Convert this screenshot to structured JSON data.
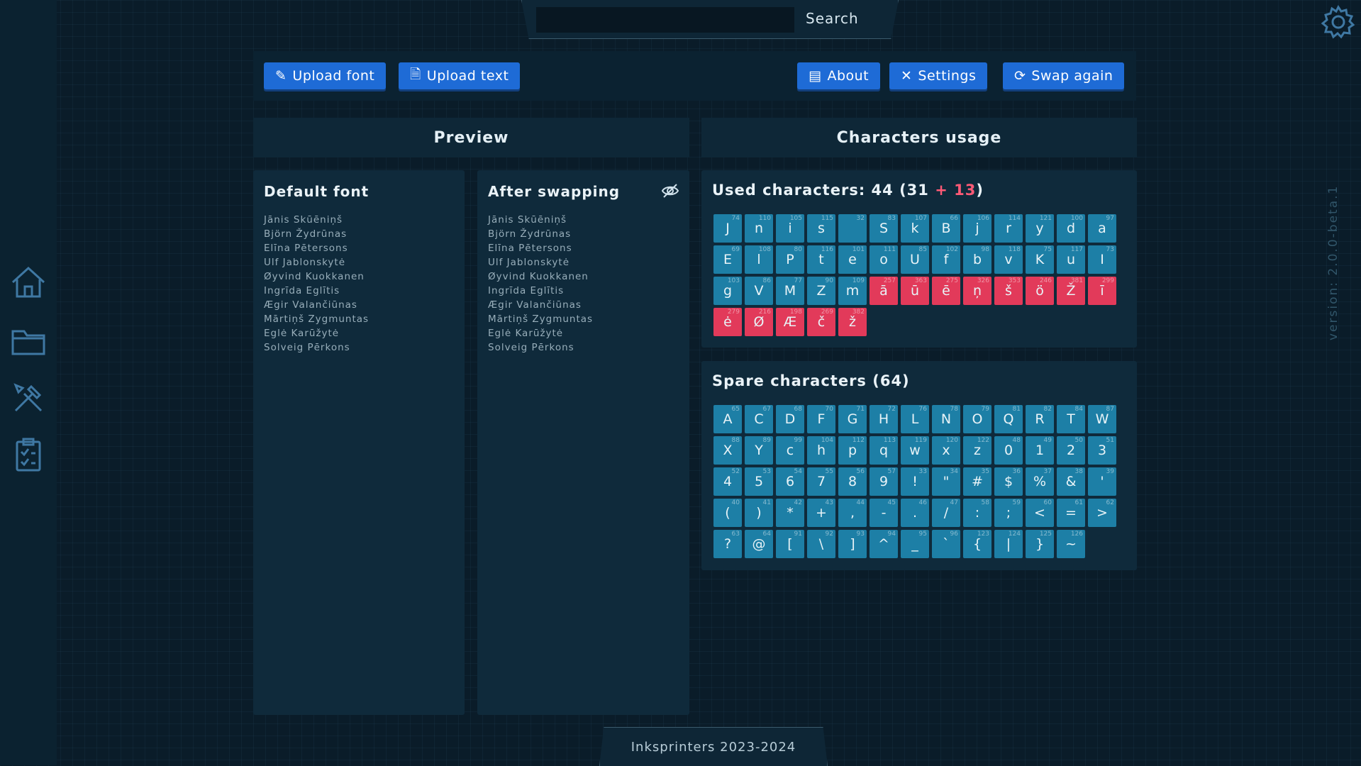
{
  "search": {
    "label": "Search",
    "placeholder": ""
  },
  "toolbar": {
    "upload_font": "Upload font",
    "upload_text": "Upload text",
    "about": "About",
    "settings": "Settings",
    "swap_again": "Swap again"
  },
  "panels": {
    "preview": "Preview",
    "characters_usage": "Characters usage"
  },
  "preview": {
    "default_font_title": "Default font",
    "after_swapping_title": "After swapping",
    "names": [
      "Jānis Skūēniņš",
      "Björn Žydrūnas",
      "Elīna Pētersons",
      "Ulf Jablonskytė",
      "Øyvind Kuokkanen",
      "Ingrīda Eglītis",
      "Ægir Valančiūnas",
      "Mārtiņš Zygmuntas",
      "Eglė Karūžytė",
      "Solveig Pērkons"
    ],
    "names_text": "Jānis Skūēniņš\nBjörn Žydrūnas\nElīna Pētersons\nUlf Jablonskytė\nØyvind Kuokkanen\nIngrīda Eglītis\nÆgir Valančiūnas\nMārtiņš Zygmuntas\nEglė Karūžytė\nSolveig Pērkons"
  },
  "used": {
    "title_prefix": "Used characters: 44 (31",
    "plus": " + 13",
    "suffix": ")",
    "chars": [
      {
        "c": "J",
        "n": "74",
        "s": false
      },
      {
        "c": "n",
        "n": "110",
        "s": false
      },
      {
        "c": "i",
        "n": "105",
        "s": false
      },
      {
        "c": "s",
        "n": "115",
        "s": false
      },
      {
        "c": "",
        "n": "32",
        "s": false
      },
      {
        "c": "S",
        "n": "83",
        "s": false
      },
      {
        "c": "k",
        "n": "107",
        "s": false
      },
      {
        "c": "B",
        "n": "66",
        "s": false
      },
      {
        "c": "j",
        "n": "106",
        "s": false
      },
      {
        "c": "r",
        "n": "114",
        "s": false
      },
      {
        "c": "y",
        "n": "121",
        "s": false
      },
      {
        "c": "d",
        "n": "100",
        "s": false
      },
      {
        "c": "a",
        "n": "97",
        "s": false
      },
      {
        "c": "E",
        "n": "69",
        "s": false
      },
      {
        "c": "l",
        "n": "108",
        "s": false
      },
      {
        "c": "P",
        "n": "80",
        "s": false
      },
      {
        "c": "t",
        "n": "116",
        "s": false
      },
      {
        "c": "e",
        "n": "101",
        "s": false
      },
      {
        "c": "o",
        "n": "111",
        "s": false
      },
      {
        "c": "U",
        "n": "85",
        "s": false
      },
      {
        "c": "f",
        "n": "102",
        "s": false
      },
      {
        "c": "b",
        "n": "98",
        "s": false
      },
      {
        "c": "v",
        "n": "118",
        "s": false
      },
      {
        "c": "K",
        "n": "75",
        "s": false
      },
      {
        "c": "u",
        "n": "117",
        "s": false
      },
      {
        "c": "I",
        "n": "73",
        "s": false
      },
      {
        "c": "g",
        "n": "103",
        "s": false
      },
      {
        "c": "V",
        "n": "86",
        "s": false
      },
      {
        "c": "M",
        "n": "77",
        "s": false
      },
      {
        "c": "Z",
        "n": "90",
        "s": false
      },
      {
        "c": "m",
        "n": "109",
        "s": false
      },
      {
        "c": "ā",
        "n": "257",
        "s": true
      },
      {
        "c": "ū",
        "n": "363",
        "s": true
      },
      {
        "c": "ē",
        "n": "275",
        "s": true
      },
      {
        "c": "ņ",
        "n": "326",
        "s": true
      },
      {
        "c": "š",
        "n": "353",
        "s": true
      },
      {
        "c": "ö",
        "n": "246",
        "s": true
      },
      {
        "c": "Ž",
        "n": "381",
        "s": true
      },
      {
        "c": "ī",
        "n": "299",
        "s": true
      },
      {
        "c": "ė",
        "n": "279",
        "s": true
      },
      {
        "c": "Ø",
        "n": "216",
        "s": true
      },
      {
        "c": "Æ",
        "n": "198",
        "s": true
      },
      {
        "c": "č",
        "n": "269",
        "s": true
      },
      {
        "c": "ž",
        "n": "382",
        "s": true
      }
    ]
  },
  "spare": {
    "title": "Spare characters (64)",
    "chars": [
      {
        "c": "A",
        "n": "65"
      },
      {
        "c": "C",
        "n": "67"
      },
      {
        "c": "D",
        "n": "68"
      },
      {
        "c": "F",
        "n": "70"
      },
      {
        "c": "G",
        "n": "71"
      },
      {
        "c": "H",
        "n": "72"
      },
      {
        "c": "L",
        "n": "76"
      },
      {
        "c": "N",
        "n": "78"
      },
      {
        "c": "O",
        "n": "79"
      },
      {
        "c": "Q",
        "n": "81"
      },
      {
        "c": "R",
        "n": "82"
      },
      {
        "c": "T",
        "n": "84"
      },
      {
        "c": "W",
        "n": "87"
      },
      {
        "c": "X",
        "n": "88"
      },
      {
        "c": "Y",
        "n": "89"
      },
      {
        "c": "c",
        "n": "99"
      },
      {
        "c": "h",
        "n": "104"
      },
      {
        "c": "p",
        "n": "112"
      },
      {
        "c": "q",
        "n": "113"
      },
      {
        "c": "w",
        "n": "119"
      },
      {
        "c": "x",
        "n": "120"
      },
      {
        "c": "z",
        "n": "122"
      },
      {
        "c": "0",
        "n": "48"
      },
      {
        "c": "1",
        "n": "49"
      },
      {
        "c": "2",
        "n": "50"
      },
      {
        "c": "3",
        "n": "51"
      },
      {
        "c": "4",
        "n": "52"
      },
      {
        "c": "5",
        "n": "53"
      },
      {
        "c": "6",
        "n": "54"
      },
      {
        "c": "7",
        "n": "55"
      },
      {
        "c": "8",
        "n": "56"
      },
      {
        "c": "9",
        "n": "57"
      },
      {
        "c": "!",
        "n": "33"
      },
      {
        "c": "\"",
        "n": "34"
      },
      {
        "c": "#",
        "n": "35"
      },
      {
        "c": "$",
        "n": "36"
      },
      {
        "c": "%",
        "n": "37"
      },
      {
        "c": "&",
        "n": "38"
      },
      {
        "c": "'",
        "n": "39"
      },
      {
        "c": "(",
        "n": "40"
      },
      {
        "c": ")",
        "n": "41"
      },
      {
        "c": "*",
        "n": "42"
      },
      {
        "c": "+",
        "n": "43"
      },
      {
        "c": ",",
        "n": "44"
      },
      {
        "c": "-",
        "n": "45"
      },
      {
        "c": ".",
        "n": "46"
      },
      {
        "c": "/",
        "n": "47"
      },
      {
        "c": ":",
        "n": "58"
      },
      {
        "c": ";",
        "n": "59"
      },
      {
        "c": "<",
        "n": "60"
      },
      {
        "c": "=",
        "n": "61"
      },
      {
        "c": ">",
        "n": "62"
      },
      {
        "c": "?",
        "n": "63"
      },
      {
        "c": "@",
        "n": "64"
      },
      {
        "c": "[",
        "n": "91"
      },
      {
        "c": "\\",
        "n": "92"
      },
      {
        "c": "]",
        "n": "93"
      },
      {
        "c": "^",
        "n": "94"
      },
      {
        "c": "_",
        "n": "95"
      },
      {
        "c": "`",
        "n": "96"
      },
      {
        "c": "{",
        "n": "123"
      },
      {
        "c": "|",
        "n": "124"
      },
      {
        "c": "}",
        "n": "125"
      },
      {
        "c": "~",
        "n": "126"
      }
    ]
  },
  "version": "version: 2.0.0-beta.1",
  "footer": "Inksprinters 2023-2024",
  "colors": {
    "accent": "#1e6bd6",
    "swapped": "#e23a5a",
    "cell": "#1d7fa6",
    "panel": "#0f2a3b"
  },
  "icons": [
    "home-icon",
    "folder-icon",
    "tools-icon",
    "clipboard-icon",
    "gear-icon",
    "eye-off-icon",
    "pencil-icon",
    "file-icon",
    "book-icon",
    "wrench-icon",
    "refresh-icon"
  ]
}
